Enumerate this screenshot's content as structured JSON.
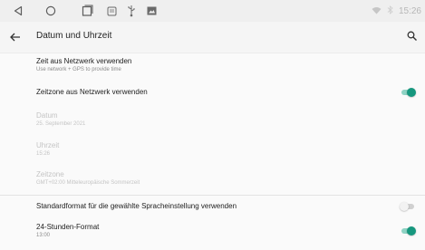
{
  "status_bar": {
    "time": "15:26",
    "icons": [
      "back-triangle-icon",
      "home-circle-icon",
      "recents-square-icon",
      "screenshot-icon",
      "usb-icon",
      "image-icon",
      "wifi-icon",
      "bluetooth-icon"
    ]
  },
  "app_bar": {
    "title": "Datum und Uhrzeit",
    "back_icon": "arrow-back-icon",
    "search_icon": "search-icon"
  },
  "settings": {
    "network_time": {
      "title": "Zeit aus Netzwerk verwenden",
      "summary": "Use network + GPS to provide time"
    },
    "network_zone": {
      "title": "Zeitzone aus Netzwerk verwenden",
      "toggle_on": true
    },
    "date": {
      "title": "Datum",
      "summary": "25. September 2021",
      "enabled": false
    },
    "time": {
      "title": "Uhrzeit",
      "summary": "15:26",
      "enabled": false
    },
    "zone": {
      "title": "Zeitzone",
      "summary": "GMT+02:00 Mitteleuropäische Sommerzeit",
      "enabled": false
    },
    "locale_format": {
      "title": "Standardformat für die gewählte Spracheinstellung verwenden",
      "toggle_on": false
    },
    "h24": {
      "title": "24-Stunden-Format",
      "summary": "13:00",
      "toggle_on": true
    }
  },
  "colors": {
    "accent": "#16977e",
    "accent_track": "#8fd3c4"
  }
}
